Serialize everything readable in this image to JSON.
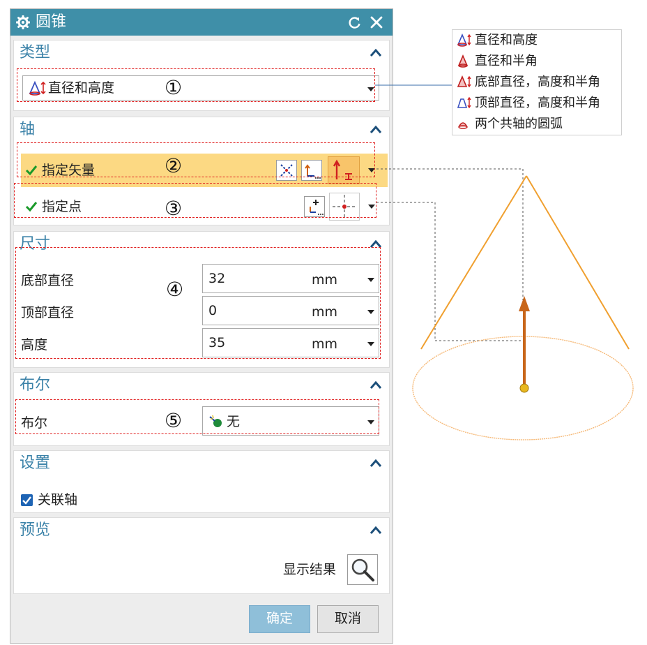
{
  "dialog": {
    "title": "圆锥",
    "icons": {
      "settings": "gear-icon",
      "reset": "reset-icon",
      "close": "close-icon"
    }
  },
  "type_group": {
    "title": "类型",
    "selected": "直径和高度",
    "callout": "①"
  },
  "type_options": [
    "直径和高度",
    "直径和半角",
    "底部直径，高度和半角",
    "顶部直径，高度和半角",
    "两个共轴的圆弧"
  ],
  "axis_group": {
    "title": "轴",
    "vector_label": "指定矢量",
    "vector_callout": "②",
    "point_label": "指定点",
    "point_callout": "③"
  },
  "dimensions_group": {
    "title": "尺寸",
    "callout": "④",
    "rows": [
      {
        "label": "底部直径",
        "value": "32",
        "unit": "mm"
      },
      {
        "label": "顶部直径",
        "value": "0",
        "unit": "mm"
      },
      {
        "label": "高度",
        "value": "35",
        "unit": "mm"
      }
    ]
  },
  "boolean_group": {
    "title": "布尔",
    "label": "布尔",
    "value": "无",
    "callout": "⑤"
  },
  "settings_group": {
    "title": "设置",
    "associate_axis_label": "关联轴",
    "associate_axis_checked": true
  },
  "preview_group": {
    "title": "预览",
    "show_result_label": "显示结果"
  },
  "footer": {
    "ok_label": "确定",
    "cancel_label": "取消"
  },
  "colors": {
    "title_bar": "#3f8fa8",
    "group_title": "#3b82a8",
    "highlight_row": "#fcd983",
    "callout_dash": "#e02020",
    "cone": "#f0a030",
    "axis_arrow": "#d06010"
  }
}
